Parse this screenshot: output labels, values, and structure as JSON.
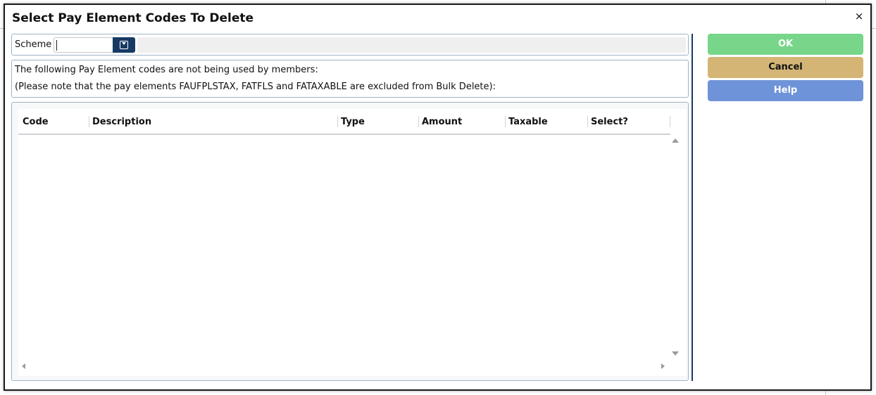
{
  "dialog": {
    "title": "Select Pay Element Codes To Delete",
    "close_glyph": "×"
  },
  "scheme": {
    "label": "Scheme",
    "value": "",
    "description": ""
  },
  "notes": {
    "line1": "The following Pay Element codes are not being used by members:",
    "line2": "(Please note that the pay elements FAUFPLSTAX, FATFLS and FATAXABLE are excluded from Bulk Delete):"
  },
  "grid": {
    "columns": [
      "Code",
      "Description",
      "Type",
      "Amount",
      "Taxable",
      "Select?"
    ],
    "rows": []
  },
  "buttons": {
    "ok": "OK",
    "cancel": "Cancel",
    "help": "Help"
  },
  "colors": {
    "ok": "#77d68a",
    "cancel": "#d4b575",
    "help": "#6f93d8",
    "accent_navy": "#163a64"
  },
  "icons": {
    "close": "close-icon",
    "dropdown": "dropdown-icon",
    "scroll_up": "arrow-up-icon",
    "scroll_down": "arrow-down-icon",
    "scroll_left": "arrow-left-icon",
    "scroll_right": "arrow-right-icon"
  }
}
